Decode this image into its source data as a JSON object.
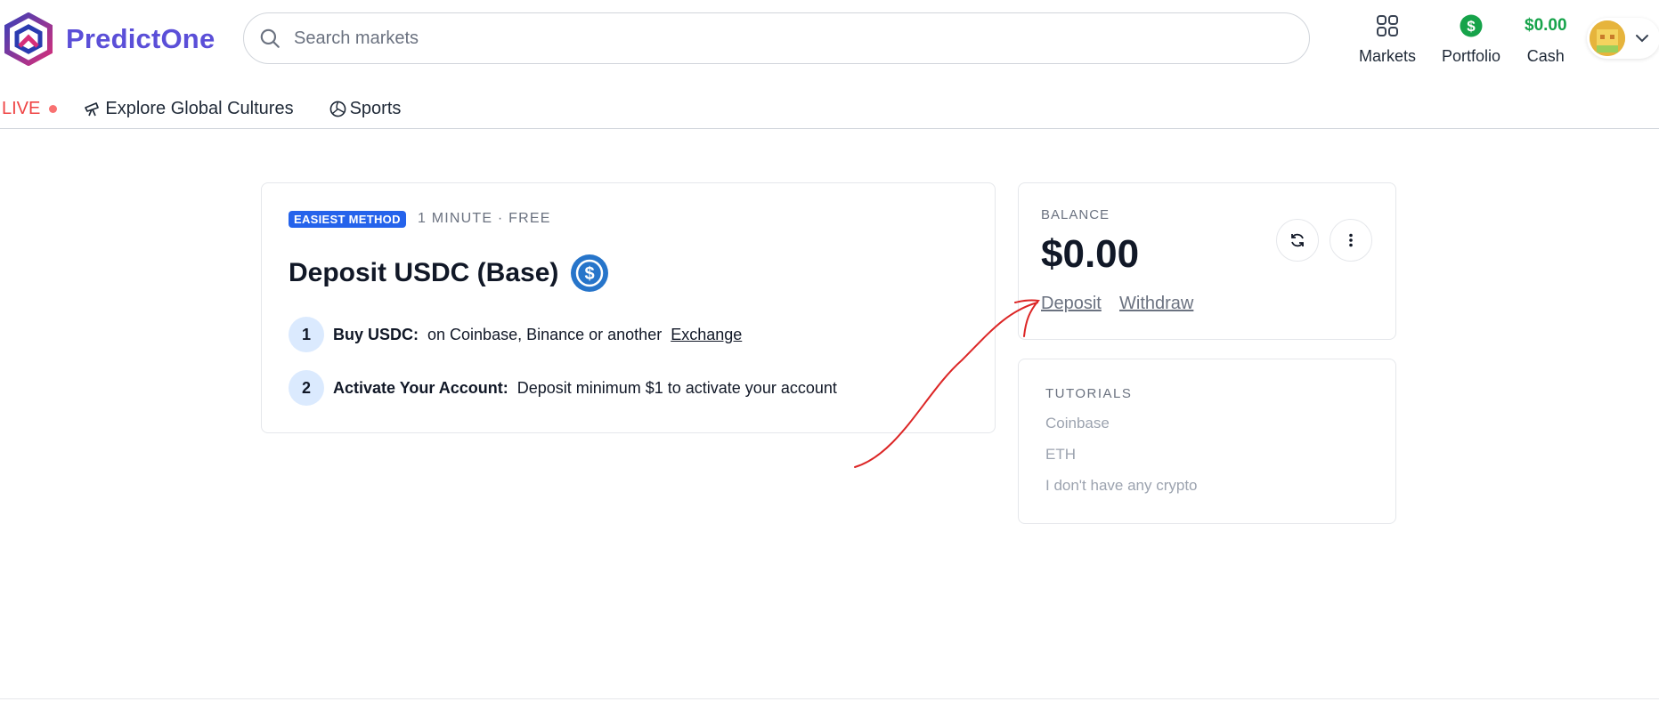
{
  "header": {
    "brand": "PredictOne",
    "search_placeholder": "Search markets",
    "nav": {
      "markets": "Markets",
      "portfolio": "Portfolio",
      "cash_amount": "$0.00",
      "cash_label": "Cash"
    }
  },
  "subnav": {
    "live": "LIVE",
    "items": [
      "Explore Global Cultures",
      "Sports"
    ]
  },
  "deposit": {
    "badge": "EASIEST METHOD",
    "meta": "1 MINUTE · FREE",
    "title": "Deposit USDC (Base)",
    "steps": [
      {
        "num": "1",
        "label": "Buy USDC:",
        "text": "on Coinbase, Binance or another",
        "link": "Exchange"
      },
      {
        "num": "2",
        "label": "Activate Your Account:",
        "text": "Deposit minimum $1 to activate your account"
      }
    ]
  },
  "balance": {
    "label": "BALANCE",
    "amount": "$0.00",
    "deposit": "Deposit",
    "withdraw": "Withdraw"
  },
  "tutorials": {
    "label": "TUTORIALS",
    "items": [
      "Coinbase",
      "ETH",
      "I don't have any crypto"
    ]
  },
  "colors": {
    "brand": "#5b4fd8",
    "cash": "#16a34a",
    "live": "#ef4444",
    "badge": "#2563eb",
    "annotation": "#dc2626"
  }
}
